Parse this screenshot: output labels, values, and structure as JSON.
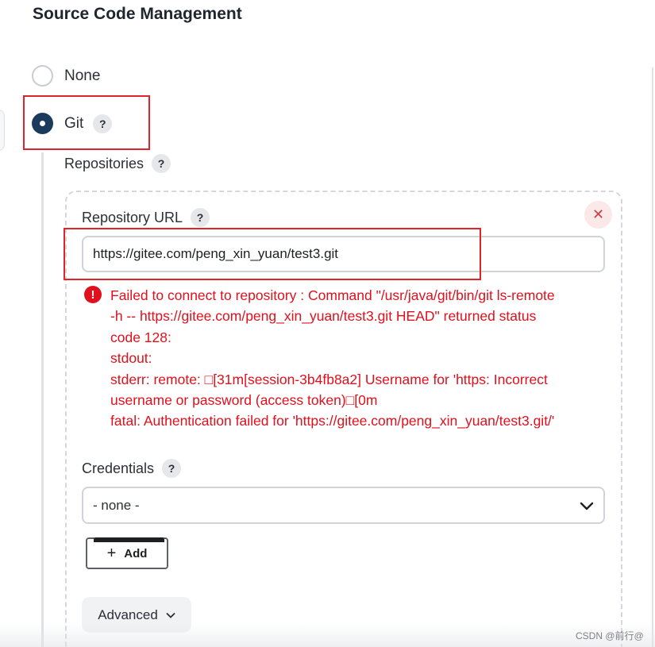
{
  "section": {
    "title": "Source Code Management"
  },
  "scm_options": [
    {
      "label": "None",
      "selected": false
    },
    {
      "label": "Git",
      "selected": true
    }
  ],
  "help_icon": {
    "glyph": "?"
  },
  "repositories": {
    "label": "Repositories",
    "url_label": "Repository URL",
    "url_value": "https://gitee.com/peng_xin_yuan/test3.git",
    "delete_glyph": "✕",
    "error": {
      "icon": "!",
      "message": "Failed to connect to repository : Command \"/usr/java/git/bin/git ls-remote\n-h -- https://gitee.com/peng_xin_yuan/test3.git HEAD\" returned status\ncode 128:\nstdout:\nstderr: remote: □[31m[session-3b4fb8a2] Username for 'https: Incorrect\nusername or password (access token)□[0m\nfatal: Authentication failed for 'https://gitee.com/peng_xin_yuan/test3.git/'"
    },
    "credentials_label": "Credentials",
    "credentials_value": "- none -",
    "add_label": "Add",
    "advanced_label": "Advanced"
  },
  "watermark": "CSDN @前行@",
  "colors": {
    "error": "#e0101c",
    "highlight": "#e0242c",
    "radio_checked": "#1b3a5c"
  }
}
